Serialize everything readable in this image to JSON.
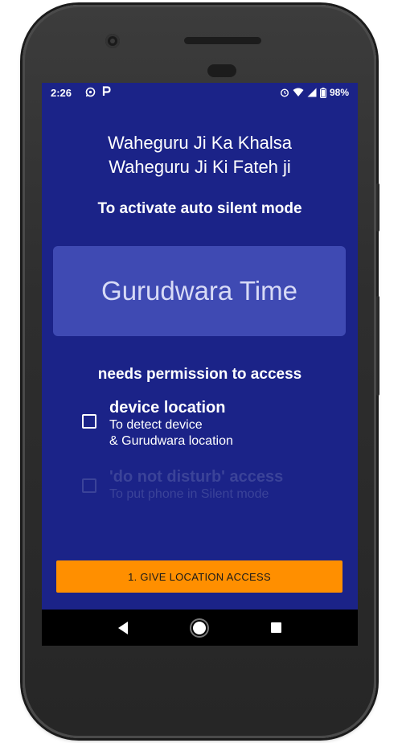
{
  "status_bar": {
    "time": "2:26",
    "app_icon_1": "whatsapp-icon",
    "app_icon_2": "p-icon",
    "battery": "98%",
    "icons": [
      "alarm-icon",
      "wifi-icon",
      "signal-icon",
      "battery-icon"
    ]
  },
  "greeting": {
    "line1": "Waheguru Ji Ka Khalsa",
    "line2": "Waheguru Ji Ki Fateh ji"
  },
  "subtitle": "To activate auto silent mode",
  "brand": "Gurudwara Time",
  "permissions": {
    "title": "needs permission to access",
    "items": [
      {
        "label": "device location",
        "desc_line1": "To detect device",
        "desc_line2": "& Gurudwara location",
        "checked": false,
        "enabled": true
      },
      {
        "label": "'do not disturb' access",
        "desc_line1": "To put phone in Silent mode",
        "checked": false,
        "enabled": false
      }
    ]
  },
  "action_button": "1. GIVE LOCATION ACCESS",
  "navbar": [
    "back-icon",
    "home-icon",
    "recents-icon"
  ],
  "colors": {
    "background": "#1b2388",
    "brand_box": "#3f4ab3",
    "button": "#ff8f00",
    "disabled_text": "#3b4399"
  }
}
